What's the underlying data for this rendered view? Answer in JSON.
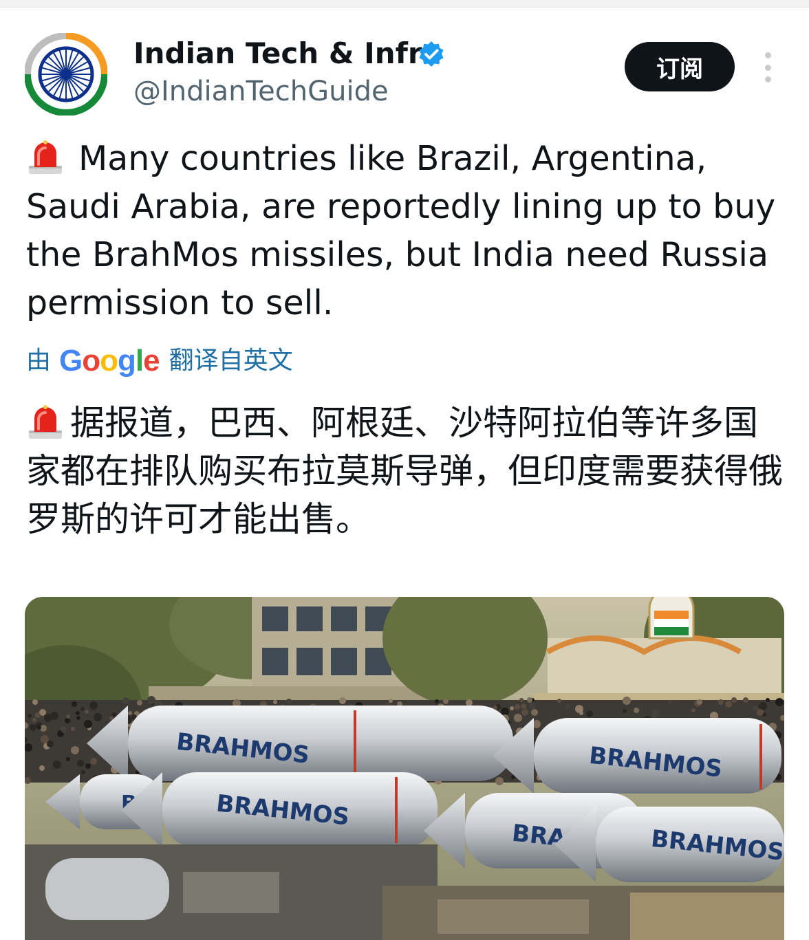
{
  "tweet": {
    "display_name": "Indian Tech & Infra",
    "handle": "@IndianTechGuide",
    "subscribe_label": "订阅",
    "text_en": "Many countries like Brazil, Argentina, Saudi Arabia, are reportedly lining up to buy the BrahMos missiles, but India need Russia permission to sell.",
    "translate_prefix": "由",
    "translate_brand": "Google",
    "translate_suffix": "翻译自英文",
    "text_zh": "据报道，巴西、阿根廷、沙特阿拉伯等许多国家都在排队购买布拉莫斯导弹，但印度需要获得俄罗斯的许可才能出售。"
  },
  "media": {
    "missile_label": "BRAHMOS",
    "missile_label_partial_1": "BR",
    "missile_label_partial_2": "BRA"
  },
  "icons": {
    "avatar": "india-ashoka-chakra-avatar",
    "verified": "verified-badge-icon",
    "more": "more-vertical-icon",
    "siren": "police-siren-emoji"
  },
  "colors": {
    "verified_blue": "#1d9bf0",
    "button_bg": "#0f1419",
    "link_blue": "#1d6fa5",
    "muted_text": "#536471"
  }
}
